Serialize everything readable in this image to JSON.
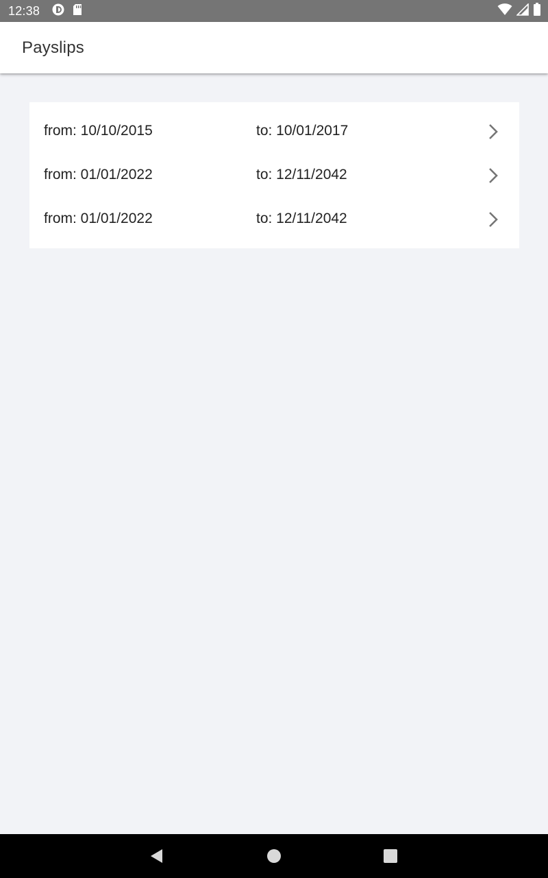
{
  "status_bar": {
    "time": "12:38",
    "left_icons": [
      "app-notification-icon",
      "sd-card-icon"
    ],
    "right_icons": [
      "wifi-icon",
      "cell-signal-icon",
      "battery-icon"
    ]
  },
  "app_bar": {
    "title": "Payslips"
  },
  "payslips": [
    {
      "from": "from: 10/10/2015",
      "to": "to: 10/01/2017"
    },
    {
      "from": "from: 01/01/2022",
      "to": "to: 12/11/2042"
    },
    {
      "from": "from: 01/01/2022",
      "to": "to: 12/11/2042"
    }
  ],
  "nav_bar": {
    "buttons": [
      "back-icon",
      "home-icon",
      "recents-icon"
    ]
  },
  "colors": {
    "status_bar": "#757575",
    "app_bar": "#ffffff",
    "background": "#f2f3f7",
    "card": "#ffffff",
    "chevron": "#757575",
    "nav_bar": "#000000"
  }
}
